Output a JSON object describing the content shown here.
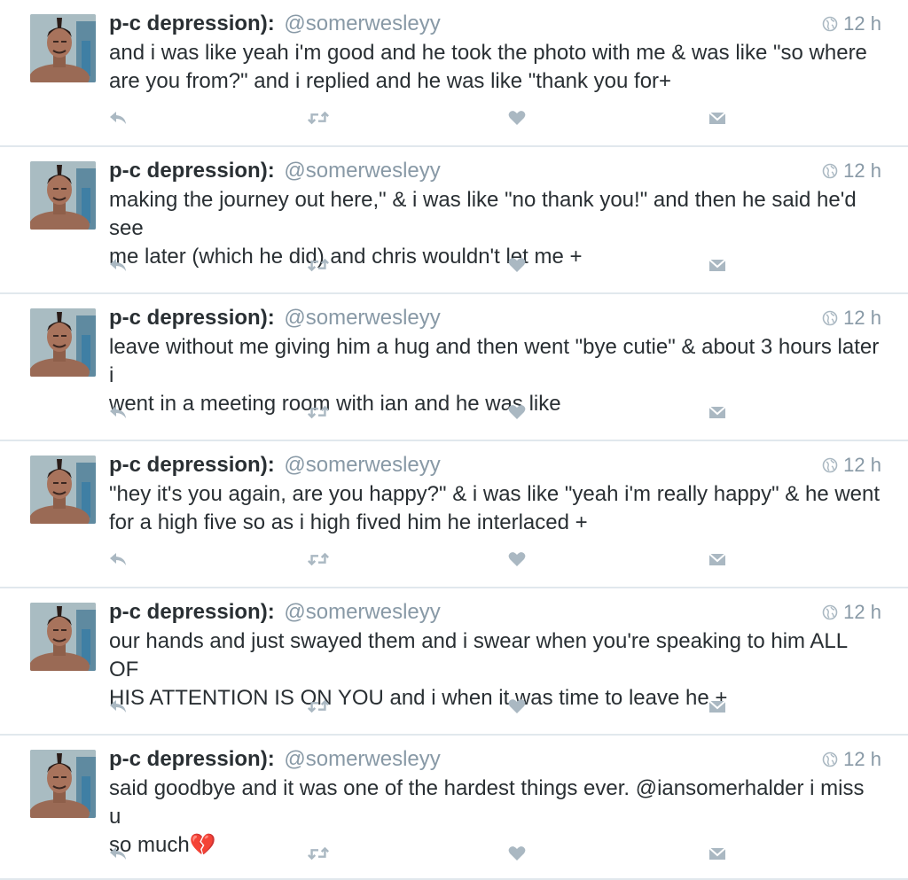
{
  "colors": {
    "text": "#292f33",
    "muted": "#8899a6",
    "icon": "#aab8c2",
    "divider": "#e1e8ed"
  },
  "tweets": [
    {
      "name": "p-c depression):",
      "handle": "@somerwesleyy",
      "time": "12 h",
      "text": "and i was like yeah i'm good and he took the photo with me & was like \"so where\nare you from?\" and i replied and he was like \"thank you for+"
    },
    {
      "name": "p-c depression):",
      "handle": "@somerwesleyy",
      "time": "12 h",
      "text": "making the journey out here,\" & i was like \"no thank you!\" and then he said he'd see\nme later (which he did) and chris wouldn't let me +"
    },
    {
      "name": "p-c depression):",
      "handle": "@somerwesleyy",
      "time": "12 h",
      "text": "leave without me giving him a hug and then went \"bye cutie\" & about 3 hours later i\nwent in a meeting room with ian and he was like"
    },
    {
      "name": "p-c depression):",
      "handle": "@somerwesleyy",
      "time": "12 h",
      "text": "\"hey it's you again, are you happy?\" & i was like \"yeah i'm really happy\" & he went\nfor a high five so as i high fived him he interlaced +"
    },
    {
      "name": "p-c depression):",
      "handle": "@somerwesleyy",
      "time": "12 h",
      "text": "our hands and just swayed them and i swear when you're speaking to him ALL OF\nHIS ATTENTION IS ON YOU and i when it was time to leave he +"
    },
    {
      "name": "p-c depression):",
      "handle": "@somerwesleyy",
      "time": "12 h",
      "text": "said goodbye and it was one of the hardest things ever. @iansomerhalder i miss u\nso much💔"
    }
  ],
  "icons": {
    "time": "globe-icon",
    "reply": "reply-icon",
    "retweet": "retweet-icon",
    "like": "heart-icon",
    "dm": "direct-message-icon"
  }
}
